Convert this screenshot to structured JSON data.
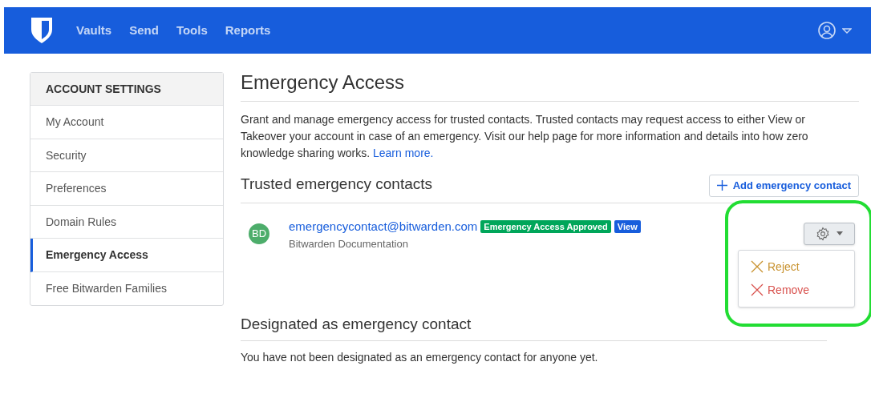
{
  "navbar": {
    "links": [
      {
        "label": "Vaults",
        "selected": false
      },
      {
        "label": "Send",
        "selected": false
      },
      {
        "label": "Tools",
        "selected": false
      },
      {
        "label": "Reports",
        "selected": false
      }
    ]
  },
  "sidebar": {
    "title": "ACCOUNT SETTINGS",
    "items": [
      {
        "label": "My Account",
        "selected": false
      },
      {
        "label": "Security",
        "selected": false
      },
      {
        "label": "Preferences",
        "selected": false
      },
      {
        "label": "Domain Rules",
        "selected": false
      },
      {
        "label": "Emergency Access",
        "selected": true
      },
      {
        "label": "Free Bitwarden Families",
        "selected": false
      }
    ]
  },
  "main": {
    "title": "Emergency Access",
    "description": "Grant and manage emergency access for trusted contacts. Trusted contacts may request access to either View or Takeover your account in case of an emergency. Visit our help page for more information and details into how zero knowledge sharing works.",
    "learn_more": "Learn more.",
    "trusted": {
      "title": "Trusted emergency contacts",
      "add_button": "Add emergency contact",
      "contacts": [
        {
          "initials": "BD",
          "email": "emergencycontact@bitwarden.com",
          "name": "Bitwarden Documentation",
          "badges": [
            {
              "label": "Emergency Access Approved",
              "color": "#00a65a"
            },
            {
              "label": "View",
              "color": "#175ddc"
            }
          ],
          "menu": {
            "expanded": true,
            "items": [
              {
                "label": "Reject",
                "kind": "warning"
              },
              {
                "label": "Remove",
                "kind": "danger"
              }
            ]
          }
        }
      ]
    },
    "designated": {
      "title": "Designated as emergency contact",
      "empty_text": "You have not been designated as an emergency contact for anyone yet."
    }
  }
}
